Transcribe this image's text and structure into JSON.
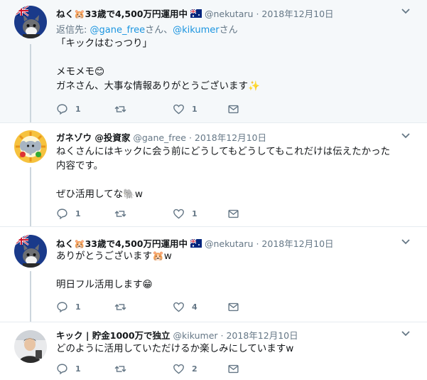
{
  "tweets": [
    {
      "name": "ねく🐹33歳で4,500万円運用中",
      "handle": "@nekutaru",
      "date": "2018年12月10日",
      "replying_prefix": "返信先: ",
      "replying_user1": "@gane_free",
      "replying_mid": "さん、",
      "replying_user2": "@kikumer",
      "replying_suffix": "さん",
      "lines": [
        "「キックはむっつり」",
        "",
        "メモメモ😊",
        "ガネさん、大事な情報ありがとうございます✨"
      ],
      "replies": "1",
      "retweets": "",
      "likes": "1"
    },
    {
      "name": "ガネゾウ @投資家",
      "handle": "@gane_free",
      "date": "2018年12月10日",
      "lines": [
        "ねくさんにはキックに会う前にどうしてもどうしてもこれだけは伝えたかった",
        "内容です。",
        "",
        "ぜひ活用してな🐘w"
      ],
      "replies": "1",
      "retweets": "",
      "likes": "1"
    },
    {
      "name": "ねく🐹33歳で4,500万円運用中",
      "handle": "@nekutaru",
      "date": "2018年12月10日",
      "lines": [
        "ありがとうございます🐹w",
        "",
        "明日フル活用します😁"
      ],
      "replies": "1",
      "retweets": "",
      "likes": "4"
    },
    {
      "name": "キック | 貯金1000万で独立",
      "handle": "@kikumer",
      "date": "2018年12月10日",
      "lines": [
        "どのように活用していただけるか楽しみにしていますw"
      ],
      "replies": "1",
      "retweets": "",
      "likes": "2"
    }
  ],
  "colors": {
    "highlight_bg": "#f5f8fa",
    "text": "#14171a",
    "muted": "#657786",
    "link": "#1b95e0",
    "thread_line": "#ccd6dd"
  },
  "icons": [
    "reply-icon",
    "retweet-icon",
    "like-icon",
    "message-icon",
    "chevron-down-icon",
    "australia-flag-icon",
    "hamster-emoji",
    "smile-emoji",
    "sparkles-emoji",
    "elephant-emoji",
    "grin-emoji"
  ]
}
